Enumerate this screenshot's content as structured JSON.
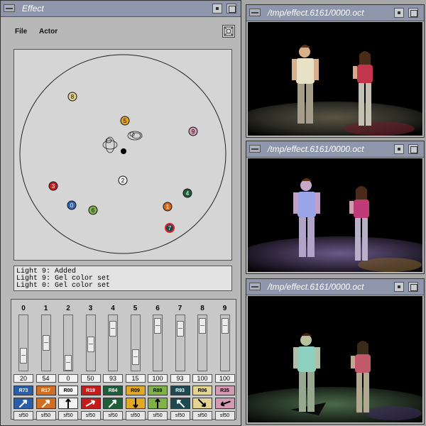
{
  "effect_window": {
    "title": "Effect",
    "menu": {
      "file": "File",
      "actor": "Actor"
    },
    "tool_icon": "lens-icon"
  },
  "stage": {
    "lights": [
      {
        "label": "0",
        "color": "#2e63b8",
        "text_color": "#ffffff"
      },
      {
        "label": "1",
        "color": "#d26a1a",
        "text_color": "#ffffff"
      },
      {
        "label": "2",
        "color": "#f0f0f0",
        "text_color": "#000000"
      },
      {
        "label": "3",
        "color": "#c41b1b",
        "text_color": "#ffffff"
      },
      {
        "label": "4",
        "color": "#1f5e3a",
        "text_color": "#ffffff"
      },
      {
        "label": "5",
        "color": "#e3a51f",
        "text_color": "#000000"
      },
      {
        "label": "6",
        "color": "#7fb34a",
        "text_color": "#000000"
      },
      {
        "label": "7",
        "color": "#1d4950",
        "text_color": "#ffffff"
      },
      {
        "label": "8",
        "color": "#e2d28a",
        "text_color": "#000000"
      },
      {
        "label": "9",
        "color": "#d59ab3",
        "text_color": "#000000"
      }
    ]
  },
  "log": [
    "Light 9: Added",
    "Light 9: Gel color set",
    "Light 0: Gel color set"
  ],
  "channels": [
    {
      "num": "0",
      "level": "20",
      "gel": "R73",
      "gel_color": "#2a5fa8",
      "gel_text": "#ffffff",
      "sf": "sf50",
      "dir_bg": "#2a5fa8",
      "arrow": "#ffffff",
      "level_frac": 0.2
    },
    {
      "num": "1",
      "level": "54",
      "gel": "R17",
      "gel_color": "#d06f22",
      "gel_text": "#ffffff",
      "sf": "sf50",
      "dir_bg": "#d06f22",
      "arrow": "#ffffff",
      "level_frac": 0.54
    },
    {
      "num": "2",
      "level": "0",
      "gel": "R00",
      "gel_color": "#f3f3f3",
      "gel_text": "#000000",
      "sf": "sf50",
      "dir_bg": "#f3f3f3",
      "arrow": "#000000",
      "level_frac": 0.0
    },
    {
      "num": "3",
      "level": "50",
      "gel": "R19",
      "gel_color": "#c41b1b",
      "gel_text": "#ffffff",
      "sf": "sf50",
      "dir_bg": "#c41b1b",
      "arrow": "#ffffff",
      "level_frac": 0.5
    },
    {
      "num": "4",
      "level": "93",
      "gel": "R84",
      "gel_color": "#1f5e3a",
      "gel_text": "#ffffff",
      "sf": "sf50",
      "dir_bg": "#1f5e3a",
      "arrow": "#ffffff",
      "level_frac": 0.93
    },
    {
      "num": "5",
      "level": "15",
      "gel": "R09",
      "gel_color": "#e0aa27",
      "gel_text": "#000000",
      "sf": "sf50",
      "dir_bg": "#e0aa27",
      "arrow": "#000000",
      "level_frac": 0.15
    },
    {
      "num": "6",
      "level": "100",
      "gel": "R89",
      "gel_color": "#7fb34a",
      "gel_text": "#000000",
      "sf": "sf50",
      "dir_bg": "#7fb34a",
      "arrow": "#000000",
      "level_frac": 1.0
    },
    {
      "num": "7",
      "level": "93",
      "gel": "R93",
      "gel_color": "#1d4950",
      "gel_text": "#ffffff",
      "sf": "sf50",
      "dir_bg": "#1d4950",
      "arrow": "#ffffff",
      "level_frac": 0.93
    },
    {
      "num": "8",
      "level": "100",
      "gel": "R06",
      "gel_color": "#e3d490",
      "gel_text": "#000000",
      "sf": "sf50",
      "dir_bg": "#e3d490",
      "arrow": "#000000",
      "level_frac": 1.0
    },
    {
      "num": "9",
      "level": "100",
      "gel": "R35",
      "gel_color": "#d59ab3",
      "gel_text": "#000000",
      "sf": "sf50",
      "dir_bg": "#d59ab3",
      "arrow": "#000000",
      "level_frac": 1.0
    }
  ],
  "render_windows": [
    {
      "title": "/tmp/effect.6161/0000.oct"
    },
    {
      "title": "/tmp/effect.6161/0000.oct"
    },
    {
      "title": "/tmp/effect.6161/0000.oct"
    }
  ]
}
